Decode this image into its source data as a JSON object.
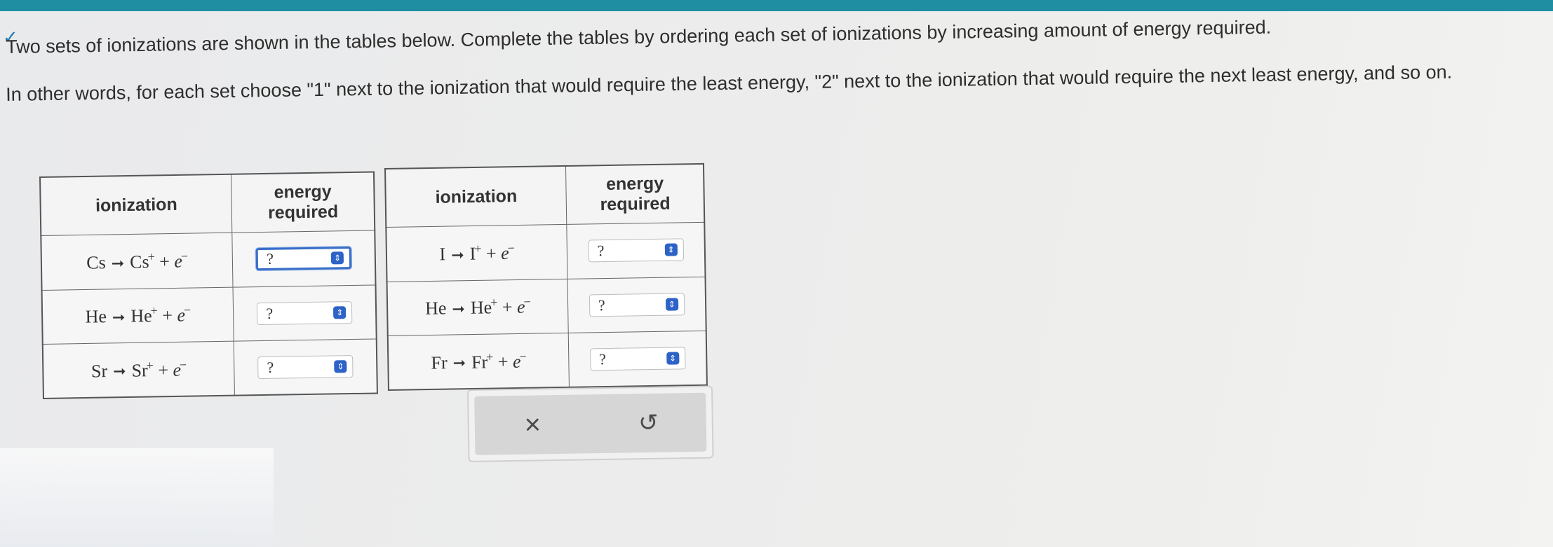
{
  "instructions": {
    "line1": "Two sets of ionizations are shown in the tables below. Complete the tables by ordering each set of ionizations by increasing amount of energy required.",
    "line2": "In other words, for each set choose \"1\" next to the ionization that would require the least energy, \"2\" next to the ionization that would require the next least energy, and so on."
  },
  "tables": [
    {
      "headers": {
        "ionization": "ionization",
        "energy": "energy required"
      },
      "rows": [
        {
          "reactant": "Cs",
          "product": "Cs",
          "product_charge": "+",
          "electron": "e",
          "electron_charge": "−",
          "select_value": "?"
        },
        {
          "reactant": "He",
          "product": "He",
          "product_charge": "+",
          "electron": "e",
          "electron_charge": "−",
          "select_value": "?"
        },
        {
          "reactant": "Sr",
          "product": "Sr",
          "product_charge": "+",
          "electron": "e",
          "electron_charge": "−",
          "select_value": "?"
        }
      ]
    },
    {
      "headers": {
        "ionization": "ionization",
        "energy": "energy required"
      },
      "rows": [
        {
          "reactant": "I",
          "product": "I",
          "product_charge": "+",
          "electron": "e",
          "electron_charge": "−",
          "select_value": "?"
        },
        {
          "reactant": "He",
          "product": "He",
          "product_charge": "+",
          "electron": "e",
          "electron_charge": "−",
          "select_value": "?"
        },
        {
          "reactant": "Fr",
          "product": "Fr",
          "product_charge": "+",
          "electron": "e",
          "electron_charge": "−",
          "select_value": "?"
        }
      ]
    }
  ],
  "buttons": {
    "clear_icon": "×",
    "reset_icon": "↺"
  },
  "icons": {
    "clear": "close-icon",
    "reset": "undo-icon",
    "select": "up-down-chevron-icon"
  },
  "colors": {
    "accent": "#2d62c7",
    "topbar": "#1f8ea3"
  }
}
